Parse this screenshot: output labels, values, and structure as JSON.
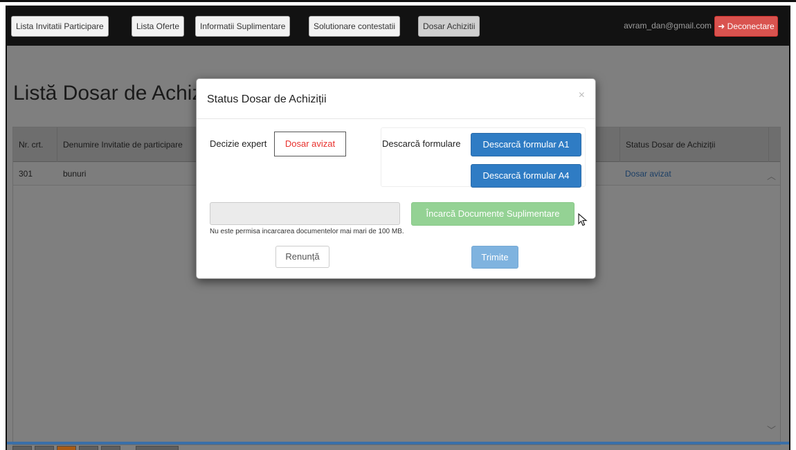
{
  "navbar": {
    "items": [
      {
        "label": "Lista Invitatii Participare"
      },
      {
        "label": "Lista Oferte"
      },
      {
        "label": "Informatii Suplimentare"
      },
      {
        "label": "Solutionare contestatii"
      },
      {
        "label": "Dosar Achizitii"
      }
    ],
    "user_email": "avram_dan@gmail.com",
    "logout_label": "Deconectare",
    "logout_icon": "sign-out-icon"
  },
  "page": {
    "title": "Listă Dosar de Achizi"
  },
  "table": {
    "headers": {
      "nr": "Nr. crt.",
      "denumire": "Denumire Invitatie de participare",
      "status": "Status Dosar de Achiziții"
    },
    "rows": [
      {
        "nr": "301",
        "denumire": "bunuri",
        "status": "Dosar avizat"
      }
    ]
  },
  "modal": {
    "title": "Status Dosar de Achiziții",
    "close_symbol": "×",
    "decision_label": "Decizie expert",
    "decision_value": "Dosar avizat",
    "download_label": "Descarcă formulare",
    "download_a1": "Descarcă formular A1",
    "download_a4": "Descarcă formular A4",
    "file_input_value": "",
    "upload_label": "Încarcă Documente Suplimentare",
    "upload_note": "Nu este permisa incarcarea documentelor mai mari de 100 MB.",
    "cancel_label": "Renunță",
    "send_label": "Trimite"
  },
  "colors": {
    "navbar_bg": "#121212",
    "logout_red": "#d9534f",
    "primary_blue": "#2f7cc4",
    "success_green": "#94d294",
    "decision_red": "#e8302c",
    "overlay_gray": "#7f7f7f"
  }
}
